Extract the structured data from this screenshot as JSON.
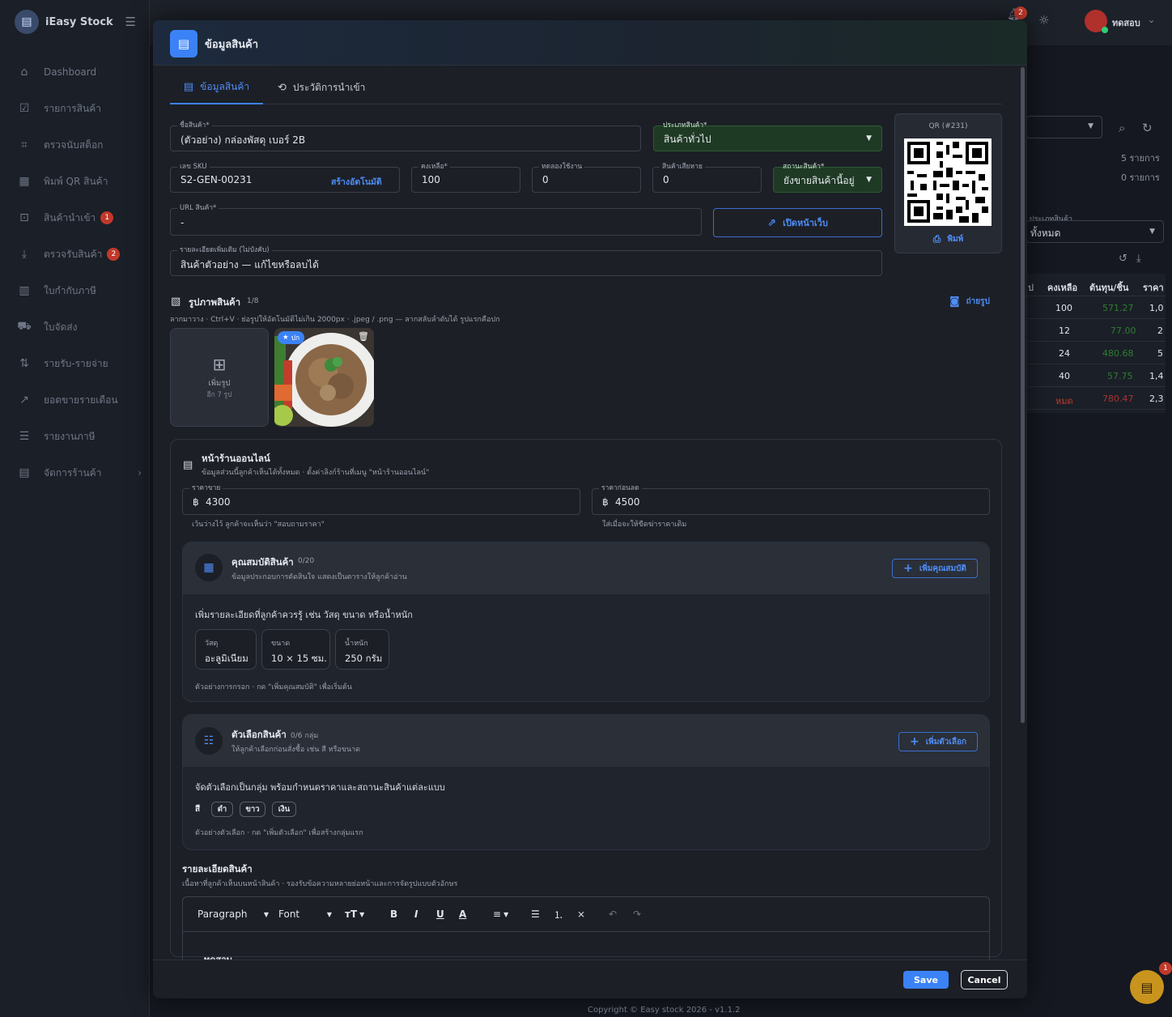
{
  "app": {
    "name": "iEasy Stock"
  },
  "sidebar": {
    "items": [
      {
        "label": "Dashboard",
        "icon": "home-icon"
      },
      {
        "label": "รายการสินค้า",
        "icon": "list-icon"
      },
      {
        "label": "ตรวจนับสต็อก",
        "icon": "scan-icon"
      },
      {
        "label": "พิมพ์ QR สินค้า",
        "icon": "qr-icon"
      },
      {
        "label": "สินค้านำเข้า",
        "icon": "import-icon",
        "badge": "1"
      },
      {
        "label": "ตรวจรับสินค้า",
        "icon": "receive-icon",
        "badge": "2"
      },
      {
        "label": "ใบกำกับภาษี",
        "icon": "invoice-icon"
      },
      {
        "label": "ใบจัดส่ง",
        "icon": "truck-icon"
      },
      {
        "label": "รายรับ-รายจ่าย",
        "icon": "transfer-icon"
      },
      {
        "label": "ยอดขายรายเดือน",
        "icon": "trend-icon"
      },
      {
        "label": "รายงานภาษี",
        "icon": "report-icon"
      },
      {
        "label": "จัดการร้านค้า",
        "icon": "store-icon"
      }
    ]
  },
  "topbar": {
    "user": "ทดสอบ",
    "notif_count": "2"
  },
  "background": {
    "count_a": "5 รายการ",
    "count_b": "0 รายการ",
    "filter_label": "ประเภทสินค้า",
    "filter_value": "ทั้งหมด",
    "headers": [
      "ป",
      "คงเหลือ",
      "ต้นทุน/ชิ้น",
      "ราคา"
    ],
    "rows": [
      {
        "qty": "100",
        "cost": "571.27",
        "price": "1,0"
      },
      {
        "qty": "12",
        "cost": "77.00",
        "price": "2"
      },
      {
        "qty": "24",
        "cost": "480.68",
        "price": "5"
      },
      {
        "qty": "40",
        "cost": "57.75",
        "price": "1,4"
      },
      {
        "qty": "หมด",
        "cost": "780.47",
        "price": "2,3"
      }
    ],
    "footer": "Copyright © Easy stock 2026 - v1.1.2",
    "fab_badge": "1"
  },
  "modal": {
    "title": "ข้อมูลสินค้า",
    "tabs": [
      "ข้อมูลสินค้า",
      "ประวัติการนำเข้า"
    ],
    "fields": {
      "name": {
        "label": "ชื่อสินค้า*",
        "value": "(ตัวอย่าง) กล่องพัสดุ เบอร์ 2B"
      },
      "type": {
        "label": "ประเภทสินค้า*",
        "value": "สินค้าทั่วไป"
      },
      "sku": {
        "label": "เลข SKU",
        "value": "S2-GEN-00231",
        "action": "สร้างอัตโนมัติ"
      },
      "stock": {
        "label": "คงเหลือ*",
        "value": "100"
      },
      "trial": {
        "label": "ทดลองใช้งาน",
        "value": "0"
      },
      "damaged": {
        "label": "สินค้าเสียหาย",
        "value": "0"
      },
      "status": {
        "label": "สถานะสินค้า*",
        "value": "ยังขายสินค้านี้อยู่"
      },
      "url": {
        "label": "URL สินค้า*",
        "value": "-",
        "button": "เปิดหน้าเว็บ"
      },
      "details": {
        "label": "รายละเอียดเพิ่มเติม (ไม่บังคับ)",
        "value": "สินค้าตัวอย่าง — แก้ไขหรือลบได้"
      }
    },
    "qr": {
      "title": "QR (#231)",
      "print": "พิมพ์"
    },
    "images": {
      "title": "รูปภาพสินค้า",
      "count": "1/8",
      "hint": "ลากมาวาง · Ctrl+V · ย่อรูปให้อัตโนมัติไม่เกิน 2000px · .jpeg / .png — ลากสลับลำดับได้ รูปแรกคือปก",
      "camera": "ถ่ายรูป",
      "add": "เพิ่มรูป",
      "add_sub": "อีก 7 รูป",
      "cover": "ปก"
    },
    "storefront": {
      "title": "หน้าร้านออนไลน์",
      "desc": "ข้อมูลส่วนนี้ลูกค้าเห็นได้ทั้งหมด · ตั้งค่าลิงก์ร้านที่เมนู \"หน้าร้านออนไลน์\"",
      "price": {
        "label": "ราคาขาย",
        "value": "4300",
        "hint": "เว้นว่างไว้ ลูกค้าจะเห็นว่า \"สอบถามราคา\""
      },
      "old_price": {
        "label": "ราคาก่อนลด",
        "value": "4500",
        "hint": "ใส่เมื่อจะให้ขีดฆ่าราคาเดิม"
      },
      "currency": "฿"
    },
    "attributes": {
      "title": "คุณสมบัติสินค้า",
      "count": "0/20",
      "desc": "ข้อมูลประกอบการตัดสินใจ แสดงเป็นตารางให้ลูกค้าอ่าน",
      "button": "เพิ่มคุณสมบัติ",
      "intro": "เพิ่มรายละเอียดที่ลูกค้าควรรู้ เช่น วัสดุ ขนาด หรือน้ำหนัก",
      "examples": [
        {
          "k": "วัสดุ",
          "v": "อะลูมิเนียม"
        },
        {
          "k": "ขนาด",
          "v": "10 × 15 ซม."
        },
        {
          "k": "น้ำหนัก",
          "v": "250 กรัม"
        }
      ],
      "foot": "ตัวอย่างการกรอก · กด \"เพิ่มคุณสมบัติ\" เพื่อเริ่มต้น"
    },
    "options": {
      "title": "ตัวเลือกสินค้า",
      "count": "0/6 กลุ่ม",
      "desc": "ให้ลูกค้าเลือกก่อนสั่งซื้อ เช่น สี หรือขนาด",
      "button": "เพิ่มตัวเลือก",
      "intro": "จัดตัวเลือกเป็นกลุ่ม พร้อมกำหนดราคาและสถานะสินค้าแต่ละแบบ",
      "group": "สี",
      "values": [
        "ดำ",
        "ขาว",
        "เงิน"
      ],
      "foot": "ตัวอย่างตัวเลือก · กด \"เพิ่มตัวเลือก\" เพื่อสร้างกลุ่มแรก"
    },
    "description": {
      "title": "รายละเอียดสินค้า",
      "desc": "เนื้อหาที่ลูกค้าเห็นบนหน้าสินค้า · รองรับข้อความหลายย่อหน้าและการจัดรูปแบบตัวอักษร",
      "paragraph": "Paragraph",
      "font": "Font",
      "content": "ทดสอบ"
    },
    "save": "Save",
    "cancel": "Cancel"
  }
}
